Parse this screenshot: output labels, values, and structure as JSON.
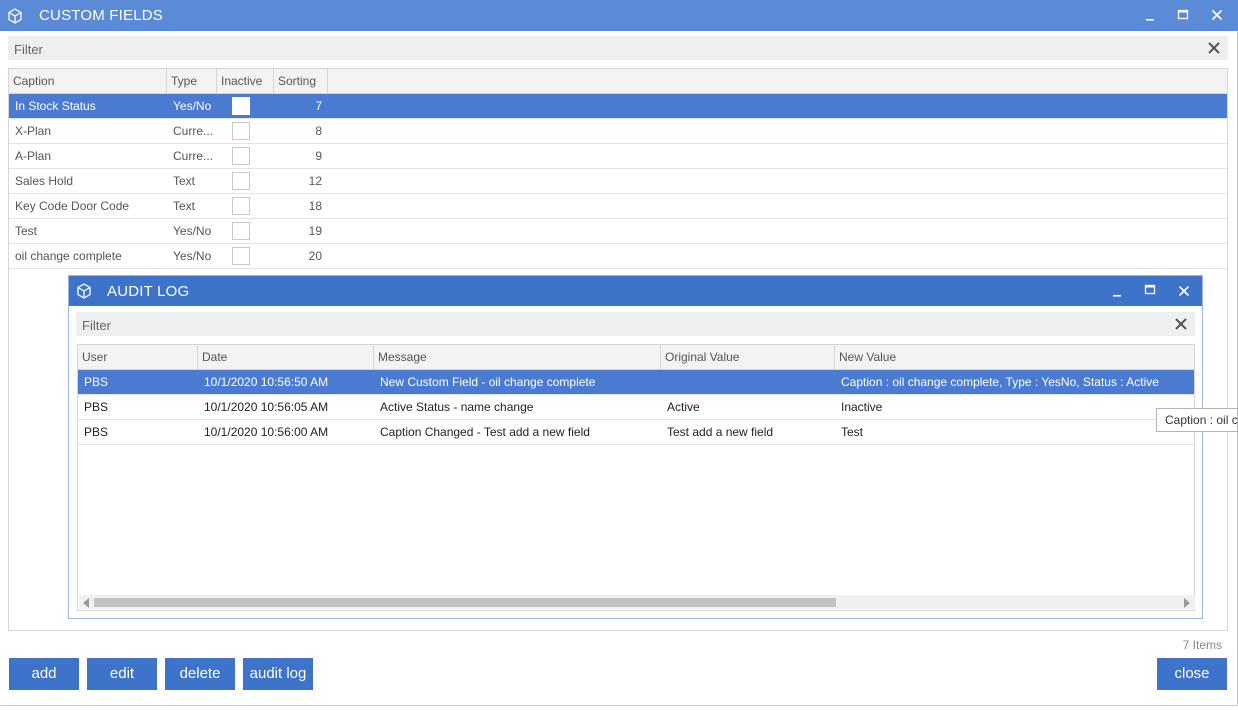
{
  "window": {
    "title": "CUSTOM FIELDS",
    "icon": "cube-icon",
    "controls": [
      "minimize-icon",
      "maximize-icon",
      "close-icon"
    ]
  },
  "filter": {
    "placeholder": "Filter",
    "clear_icon": "close-icon"
  },
  "fields_grid": {
    "columns": [
      "Caption",
      "Type",
      "Inactive",
      "Sorting"
    ],
    "rows": [
      {
        "caption": "In Stock Status",
        "type": "Yes/No",
        "inactive": false,
        "sorting": "7",
        "selected": true
      },
      {
        "caption": "X-Plan",
        "type": "Curre...",
        "inactive": false,
        "sorting": "8"
      },
      {
        "caption": "A-Plan",
        "type": "Curre...",
        "inactive": false,
        "sorting": "9"
      },
      {
        "caption": "Sales Hold",
        "type": "Text",
        "inactive": false,
        "sorting": "12"
      },
      {
        "caption": "Key Code Door Code",
        "type": "Text",
        "inactive": false,
        "sorting": "18"
      },
      {
        "caption": "Test",
        "type": "Yes/No",
        "inactive": false,
        "sorting": "19"
      },
      {
        "caption": "oil change complete",
        "type": "Yes/No",
        "inactive": false,
        "sorting": "20"
      }
    ]
  },
  "audit_log": {
    "title": "AUDIT LOG",
    "filter_placeholder": "Filter",
    "columns": [
      "User",
      "Date",
      "Message",
      "Original Value",
      "New Value"
    ],
    "rows": [
      {
        "user": "PBS",
        "date": "10/1/2020 10:56:50 AM",
        "message": "New Custom Field - oil change complete",
        "original": "",
        "new": "Caption : oil change complete, Type : YesNo, Status : Active",
        "selected": true
      },
      {
        "user": "PBS",
        "date": "10/1/2020 10:56:05 AM",
        "message": "Active Status - name change",
        "original": "Active",
        "new": "Inactive"
      },
      {
        "user": "PBS",
        "date": "10/1/2020 10:56:00 AM",
        "message": "Caption Changed - Test add a new field",
        "original": "Test add a new field",
        "new": "Test"
      }
    ]
  },
  "tooltip": "Caption : oil c",
  "items_count": "7 Items",
  "buttons": {
    "add": "add",
    "edit": "edit",
    "delete": "delete",
    "audit_log": "audit log",
    "close": "close"
  },
  "colors": {
    "titlebar": "#5b8ad6",
    "audit_titlebar": "#3d73c8",
    "selection": "#4a7bd1",
    "button": "#3d73c8"
  }
}
